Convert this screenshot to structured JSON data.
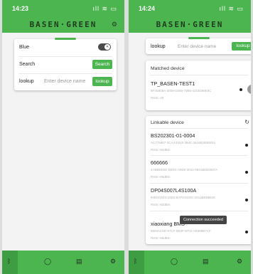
{
  "left": {
    "status_time": "14:23",
    "status_icons": "ıll ≋ ▭",
    "brand": "BASEN·GREEN",
    "rows": {
      "blue_label": "Blue",
      "search_label": "Search",
      "search_button": "Search",
      "lookup_label": "lookup",
      "device_placeholder": "Enter device name",
      "lookup_button": "lookup"
    }
  },
  "right": {
    "status_time": "14:24",
    "status_icons": "ıll ≋ ▭",
    "brand": "BASEN·GREEN",
    "lookup_label": "lookup",
    "device_placeholder": "Enter device name",
    "lookup_button": "lookup",
    "matched_title": "Matched device",
    "matched_device": {
      "name": "TP_BASEN-TEST1",
      "id": "9F4E809A-3009-D300-70B6-4216D99E9C",
      "rssi": "RSSI:-49"
    },
    "linkable_title": "Linkable device",
    "devices": [
      {
        "name": "BS202301-01-0004",
        "id": "AC776667-3CA4-E919-3B41-3616B260EE51",
        "rssi": "RSSI:-80dBm"
      },
      {
        "name": "666666",
        "id": "4ABBEE5D-BED4-A8D0-3010-0841BEB2687A",
        "rssi": "RSSI:-85dBm"
      },
      {
        "name": "DP04S007L4S100A",
        "id": "84D0AD23-22E6-BAF8-ED0C-1512BEB8645",
        "rssi": "RSSI:-82dBm"
      },
      {
        "name": "xiaoxiang BMS",
        "id": "8593AC8D-57CF-8E8F-9702-AE688B7CF",
        "rssi": "RSSI:-85dBm"
      }
    ],
    "toast": "Connection succeeded"
  },
  "icons": {
    "gear": "gear-icon",
    "refresh": "refresh-icon",
    "close": "close-icon",
    "nav_bluetooth": "bluetooth-icon",
    "nav_home": "circle-icon",
    "nav_doc": "document-icon",
    "nav_settings": "settings-icon"
  },
  "colors": {
    "brand_green": "#4cb550",
    "bar_dark_green": "#3e9c42"
  }
}
